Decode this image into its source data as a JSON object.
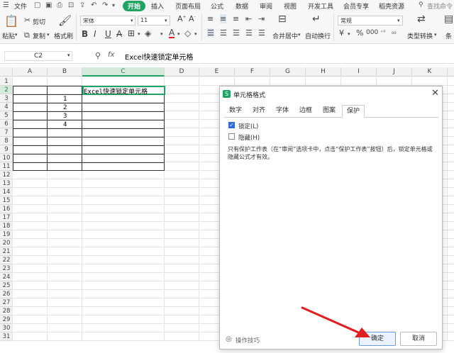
{
  "menubar": {
    "items": [
      "文件",
      "开始",
      "插入",
      "页面布局",
      "公式",
      "数据",
      "审阅",
      "视图",
      "开发工具",
      "会员专享",
      "稻壳资源"
    ],
    "search": "查找命令"
  },
  "ribbon": {
    "paste": "粘贴",
    "cut": "剪切",
    "copy": "复制",
    "format_painter": "格式刷",
    "font_name": "宋体",
    "font_size": "11",
    "merge_center": "合并居中",
    "wrap_text": "自动换行",
    "number_format": "常规",
    "type_convert": "类型转换",
    "condition": "条"
  },
  "formula_bar": {
    "cell_ref": "C2",
    "fx": "fx",
    "content": "Excel快速锁定单元格"
  },
  "grid": {
    "columns": [
      "A",
      "B",
      "C",
      "D",
      "E",
      "F",
      "G",
      "H",
      "I",
      "J",
      "K"
    ],
    "rows": [
      "1",
      "2",
      "3",
      "4",
      "5",
      "6",
      "7",
      "8",
      "9",
      "10",
      "11",
      "12",
      "13",
      "14",
      "15",
      "16",
      "17",
      "18",
      "19",
      "20",
      "21",
      "22",
      "23",
      "24",
      "25",
      "26",
      "27",
      "28",
      "29",
      "30",
      "31"
    ],
    "c2": "Excel快速锁定单元格",
    "b3": "1",
    "b4": "2",
    "b5": "3",
    "b6": "4"
  },
  "dialog": {
    "title": "单元格格式",
    "tabs": [
      "数字",
      "对齐",
      "字体",
      "边框",
      "图案",
      "保护"
    ],
    "lock_label": "锁定(L)",
    "lock_checked": true,
    "hide_label": "隐藏(H)",
    "hide_checked": false,
    "note": "只有保护工作表（在“审阅”选项卡中，点击“保护工作表”按钮）后，锁定单元格或隐藏公式才有效。",
    "tips": "操作技巧",
    "ok": "确定",
    "cancel": "取消"
  },
  "colors": {
    "accent": "#1fa463",
    "arrow": "#e02020",
    "checkbox": "#2b6fd6"
  }
}
